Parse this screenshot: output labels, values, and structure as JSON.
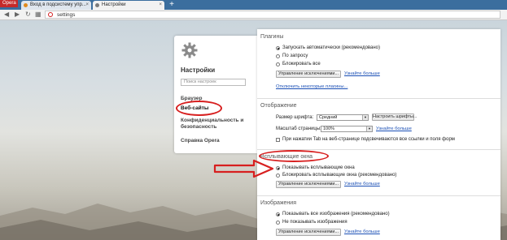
{
  "browser": {
    "opera_menu_label": "Opera",
    "tabs": [
      {
        "label": "Вход в подсистему упр...",
        "favicon_color": "#e08a1e",
        "active": false
      },
      {
        "label": "Настройки",
        "favicon_color": "#7a7a7a",
        "active": true
      }
    ],
    "new_tab_label": "+",
    "address": "settings"
  },
  "sidebar": {
    "title": "Настройки",
    "search_placeholder": "Поиск настроек",
    "items": [
      {
        "label": "Браузер"
      },
      {
        "label": "Веб-сайты"
      },
      {
        "label": "Конфиденциальность и"
      },
      {
        "label": "безопасность"
      },
      {
        "label": "Справка Opera"
      }
    ]
  },
  "plugins": {
    "title": "Плагины",
    "options": [
      "Запускать автоматически (рекомендовано)",
      "По запросу",
      "Блокировать все"
    ],
    "selected": 0,
    "manage_button": "Управление исключениями...",
    "learn_more": "Узнайте больше",
    "disable_link": "Отключить некоторые плагины..."
  },
  "display": {
    "title": "Отображение",
    "font_size_label": "Размер шрифта:",
    "font_size_value": "Средний",
    "font_button": "Настроить шрифты...",
    "zoom_label": "Масштаб страницы:",
    "zoom_value": "100%",
    "zoom_learn_more": "Узнайте больше",
    "tab_highlight_label": "При нажатии Tab на веб-странице подсвечиваются все ссылки и поля форм"
  },
  "popups": {
    "title": "Всплывающие окна",
    "options": [
      "Показывать всплывающие окна",
      "Блокировать всплывающие окна (рекомендовано)"
    ],
    "selected": 0,
    "manage_button": "Управление исключениями...",
    "learn_more": "Узнайте больше"
  },
  "images": {
    "title": "Изображения",
    "options": [
      "Показывать все изображения (рекомендовано)",
      "Не показывать изображения"
    ],
    "selected": 0,
    "manage_button": "Управление исключениями...",
    "learn_more": "Узнайте больше"
  },
  "colors": {
    "annotation": "#d71f1f",
    "link": "#1a4fb5",
    "tabbar": "#3b6e9e"
  }
}
